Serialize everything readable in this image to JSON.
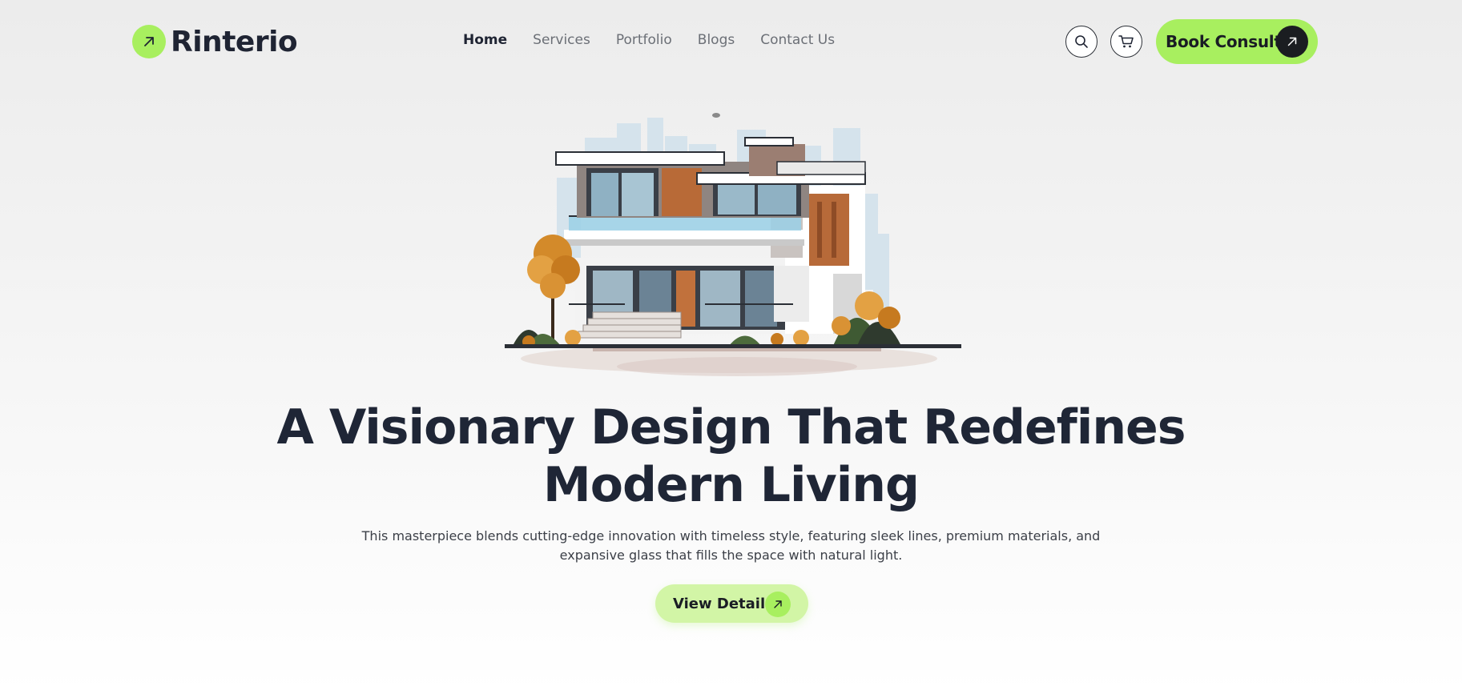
{
  "brand": {
    "name": "Rinterio",
    "accent_color": "#a8ef5f",
    "logo_icon": "arrow-up-right-icon"
  },
  "nav": {
    "items": [
      {
        "label": "Home",
        "active": true
      },
      {
        "label": "Services",
        "active": false
      },
      {
        "label": "Portfolio",
        "active": false
      },
      {
        "label": "Blogs",
        "active": false
      },
      {
        "label": "Contact Us",
        "active": false
      }
    ]
  },
  "header_actions": {
    "search_icon": "search-icon",
    "cart_icon": "cart-icon",
    "cta_label": "Book Consult",
    "cta_icon": "arrow-up-right-icon"
  },
  "hero": {
    "title_line1": "A Visionary Design That Redefines",
    "title_line2": "Modern Living",
    "subtitle_line1": "This masterpiece blends cutting-edge innovation with timeless style, featuring sleek lines, premium materials, and",
    "subtitle_line2": "expansive glass that fills the space with natural light.",
    "cta_label": "View Details",
    "cta_icon": "arrow-up-right-icon",
    "illustration": "modern-house-illustration"
  }
}
